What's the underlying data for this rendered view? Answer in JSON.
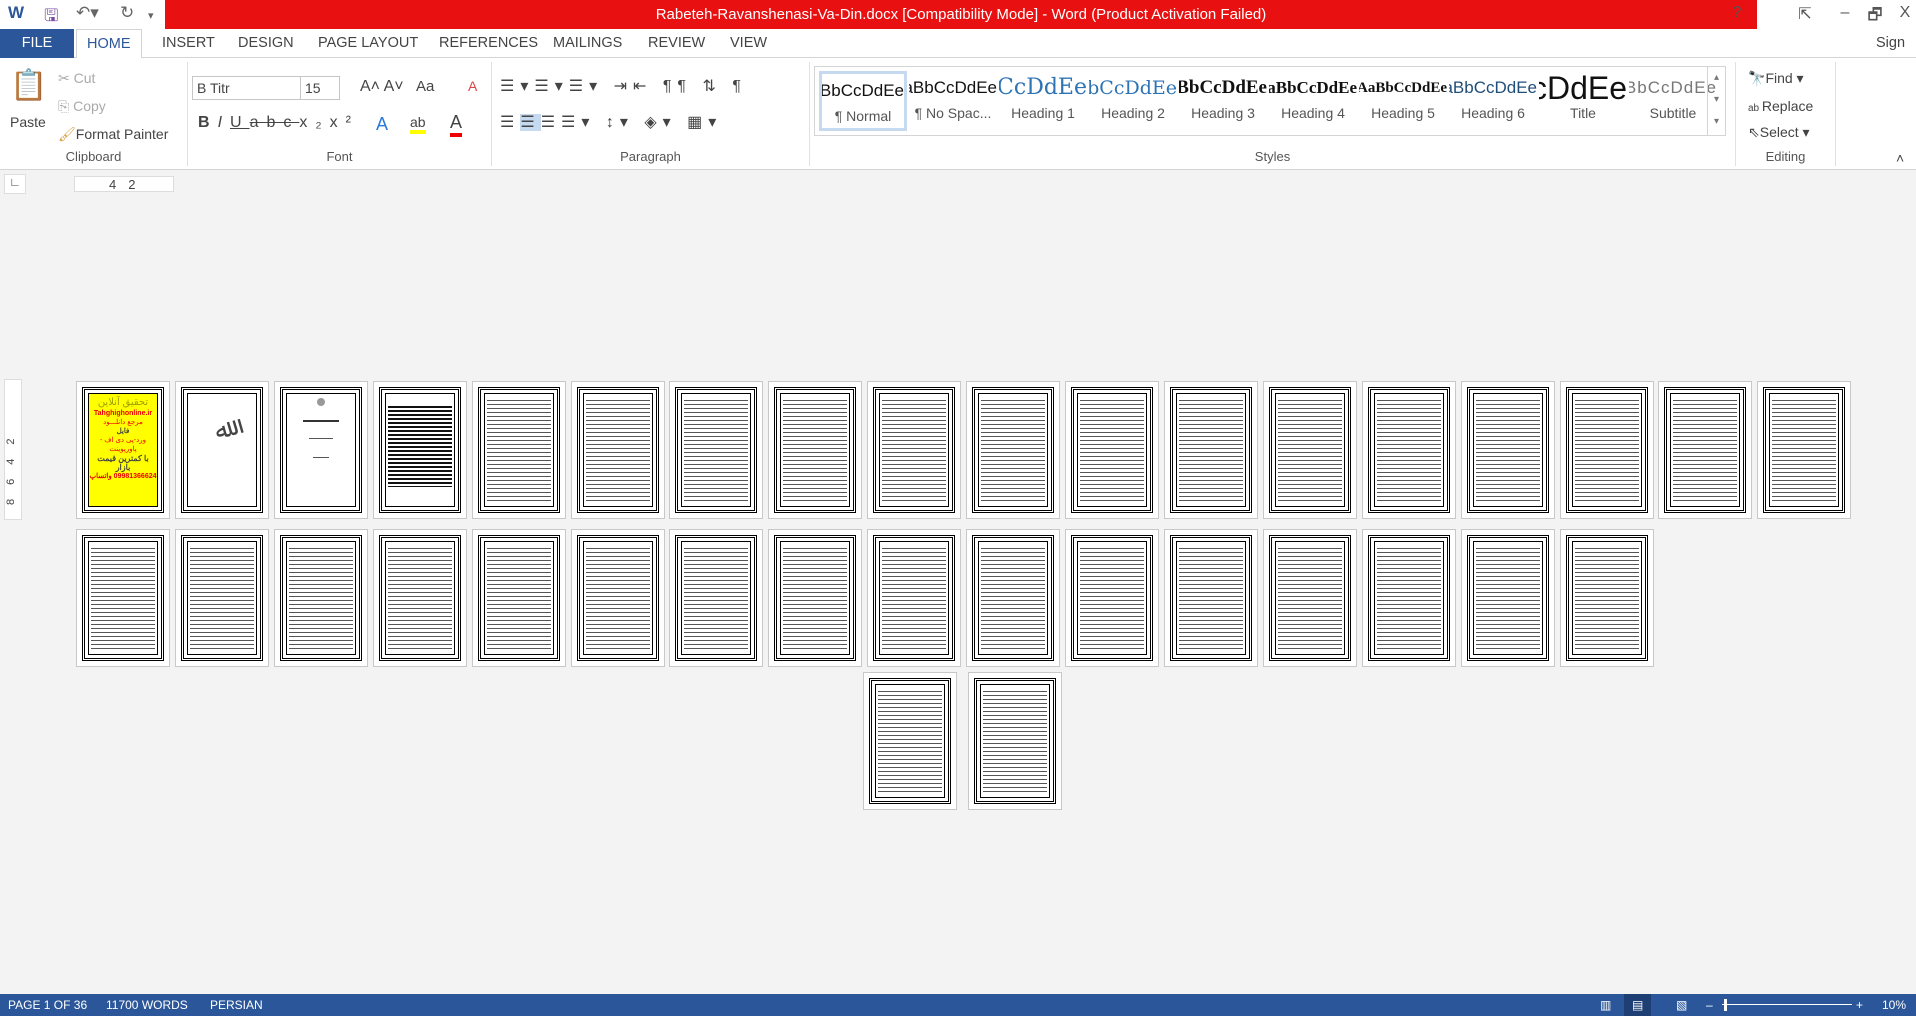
{
  "title": "Rabeteh-Ravanshenasi-Va-Din.docx [Compatibility Mode] -  Word (Product Activation Failed)",
  "window_controls": {
    "help": "?",
    "restore_ribbon": "⇱",
    "minimize": "–",
    "restore": "🗗",
    "close": "X"
  },
  "tabs": [
    "FILE",
    "HOME",
    "INSERT",
    "DESIGN",
    "PAGE LAYOUT",
    "REFERENCES",
    "MAILINGS",
    "REVIEW",
    "VIEW"
  ],
  "sign_in": "Sign in",
  "clipboard": {
    "paste": "Paste",
    "cut": "Cut",
    "copy": "Copy",
    "format_painter": "Format Painter",
    "label": "Clipboard"
  },
  "font": {
    "name": "B Titr",
    "size": "15",
    "label": "Font",
    "case": "Aa"
  },
  "paragraph": {
    "label": "Paragraph"
  },
  "styles": {
    "label": "Styles",
    "items": [
      {
        "preview": "AaBbCcDdEe",
        "name": "¶ Normal"
      },
      {
        "preview": "AaBbCcDdEe",
        "name": "¶ No Spac..."
      },
      {
        "preview": "AaBbCcDdEe",
        "name": "Heading 1"
      },
      {
        "preview": "AaBbCcDdEe",
        "name": "Heading 2"
      },
      {
        "preview": "AaBbCcDdEe",
        "name": "Heading 3"
      },
      {
        "preview": "AaBbCcDdEe",
        "name": "Heading 4"
      },
      {
        "preview": "AaBbCcDdEe",
        "name": "Heading 5"
      },
      {
        "preview": "AaBbCcDdEe",
        "name": "Heading 6"
      },
      {
        "preview": "AaBbCcDdEe",
        "name": "Title"
      },
      {
        "preview": "AaBbCcDdEe",
        "name": "Subtitle"
      }
    ]
  },
  "editing": {
    "find": "Find",
    "replace": "Replace",
    "select": "Select",
    "label": "Editing"
  },
  "ruler": {
    "marks": [
      "4",
      "2"
    ]
  },
  "vruler": {
    "marks": [
      "2",
      "4",
      "6",
      "8"
    ]
  },
  "document": {
    "page_count": 36,
    "cover": {
      "heading": "تحقیق آنلاین",
      "site": "Tahghighonline.ir",
      "line1": "مرجع دانلـــود",
      "line2": "فایل",
      "line3": "ورد-پی دی اف - پاورپوینت",
      "line4": "با کمترین قیمت بازار",
      "phone": "09981366624 واتساپ"
    }
  },
  "status": {
    "page": "PAGE 1 OF 36",
    "words": "11700 WORDS",
    "language": "PERSIAN",
    "zoom": "10%",
    "zoom_percent": 10
  },
  "colors": {
    "title_bar": "#e81010",
    "accent": "#2b579a",
    "cover_bg": "#ffff00"
  }
}
